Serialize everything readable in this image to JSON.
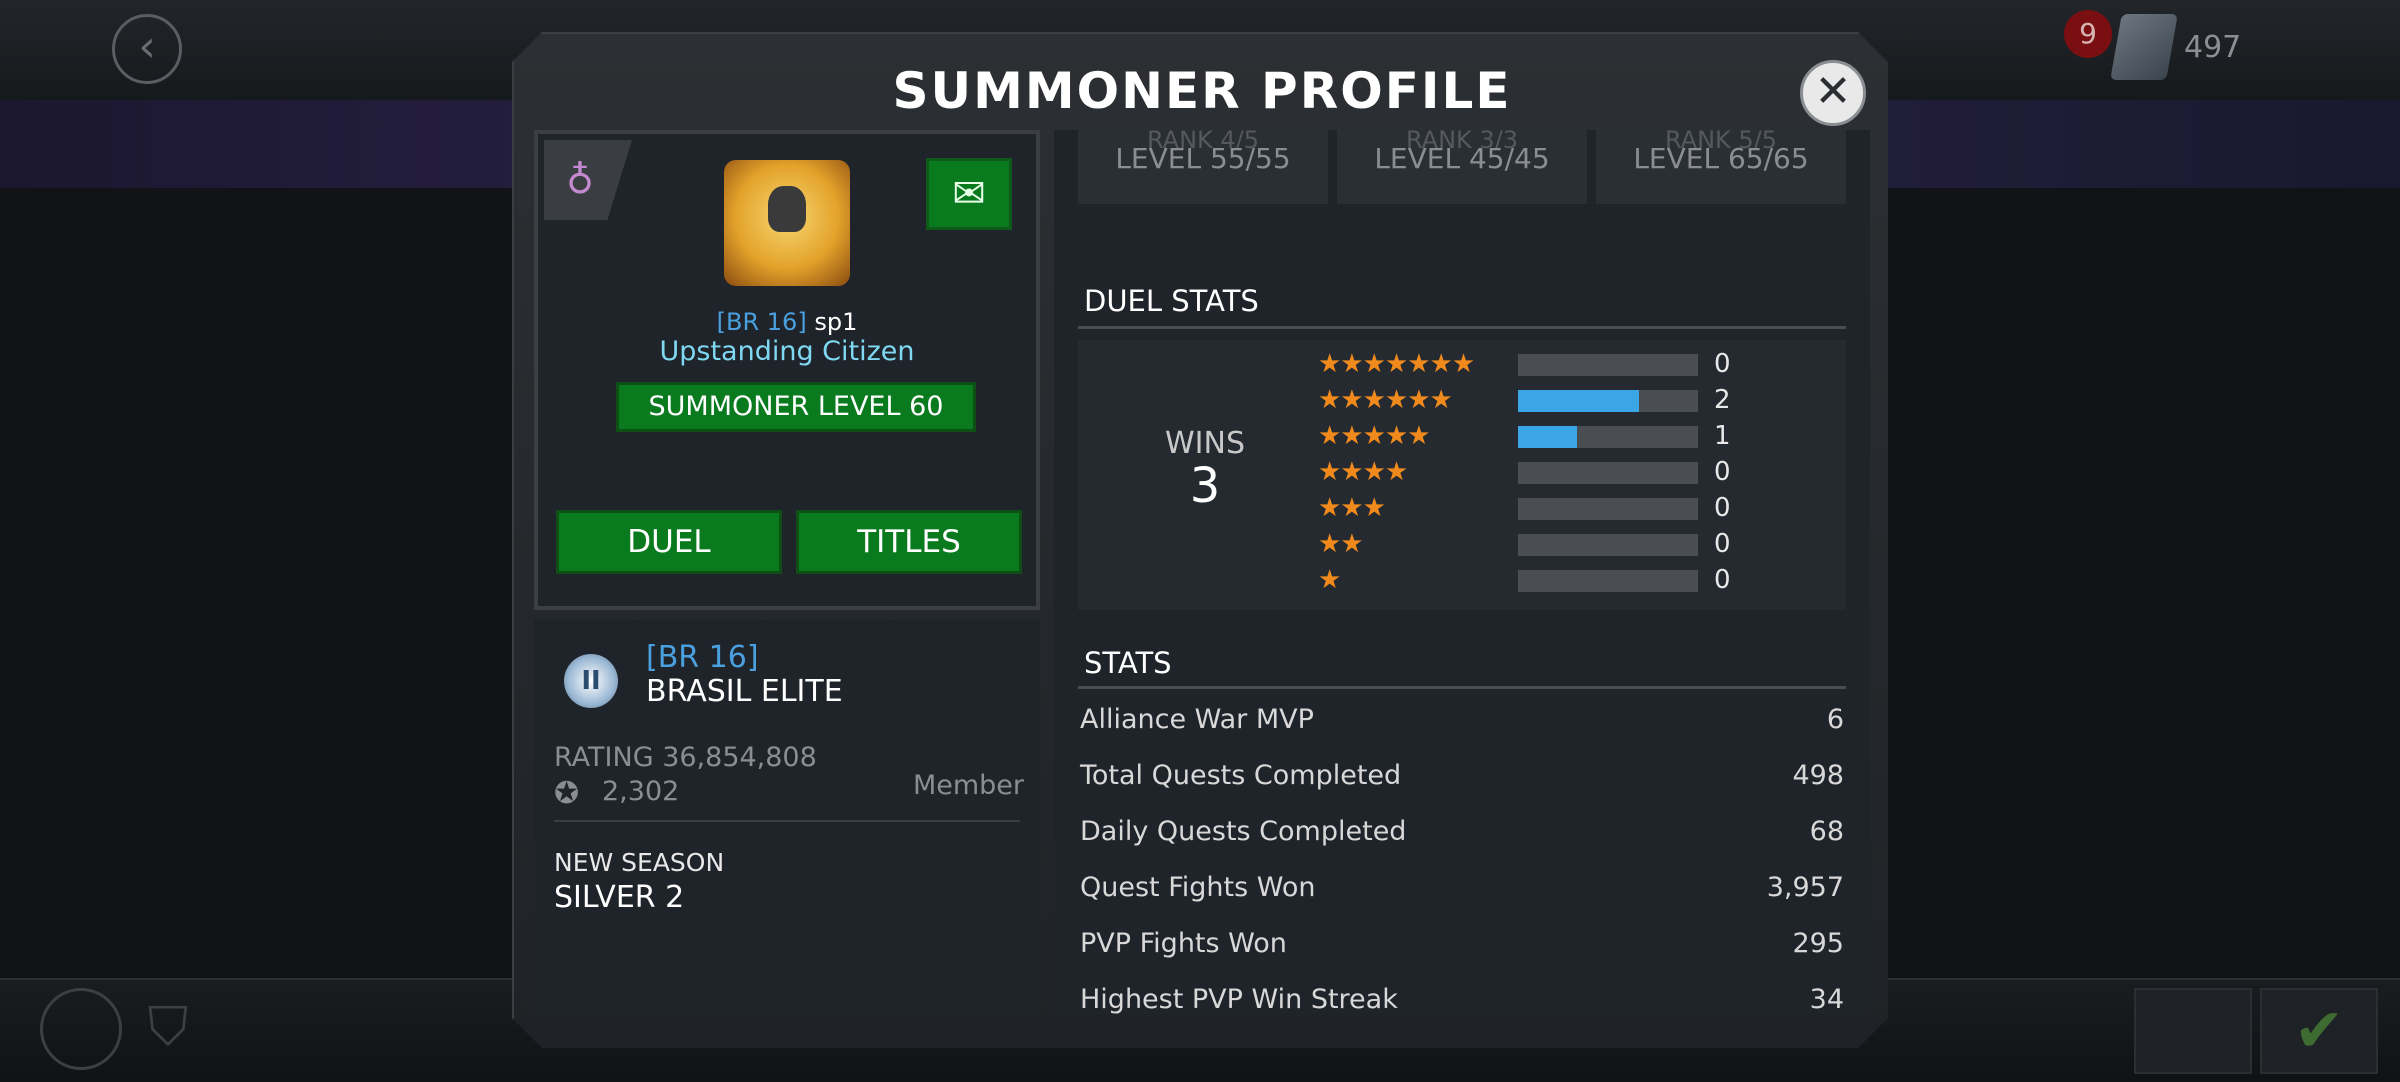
{
  "background": {
    "alert_count": "9",
    "stamina_count": "497"
  },
  "modal": {
    "title": "SUMMONER PROFILE",
    "close_symbol": "✕"
  },
  "profile": {
    "alliance_tag": "[BR 16]",
    "name": "sp1",
    "title": "Upstanding Citizen",
    "level_label": "SUMMONER LEVEL 60",
    "duel_label": "DUEL",
    "titles_label": "TITLES"
  },
  "alliance": {
    "tag": "[BR 16]",
    "name": "BRASIL ELITE",
    "rating": "RATING 36,854,808",
    "trophies": "2,302",
    "role": "Member",
    "season_label": "NEW SEASON",
    "season_value": "SILVER 2"
  },
  "ranks": [
    {
      "faded": "RANK 4/5",
      "level": "LEVEL 55/55"
    },
    {
      "faded": "RANK 3/3",
      "level": "LEVEL 45/45"
    },
    {
      "faded": "RANK 5/5",
      "level": "LEVEL 65/65"
    }
  ],
  "duel_stats": {
    "title": "DUEL STATS",
    "wins_label": "WINS",
    "wins_value": "3",
    "rows": [
      {
        "stars": "★★★★★★★",
        "count": "0",
        "fill": 0
      },
      {
        "stars": "★★★★★★",
        "count": "2",
        "fill": 0.67
      },
      {
        "stars": "★★★★★",
        "count": "1",
        "fill": 0.33
      },
      {
        "stars": "★★★★",
        "count": "0",
        "fill": 0
      },
      {
        "stars": "★★★",
        "count": "0",
        "fill": 0
      },
      {
        "stars": "★★",
        "count": "0",
        "fill": 0
      },
      {
        "stars": "★",
        "count": "0",
        "fill": 0
      }
    ]
  },
  "stats": {
    "title": "STATS",
    "rows": [
      {
        "label": "Alliance War MVP",
        "value": "6"
      },
      {
        "label": "Total Quests Completed",
        "value": "498"
      },
      {
        "label": "Daily Quests Completed",
        "value": "68"
      },
      {
        "label": "Quest Fights Won",
        "value": "3,957"
      },
      {
        "label": "PVP Fights Won",
        "value": "295"
      },
      {
        "label": "Highest PVP Win Streak",
        "value": "34"
      }
    ]
  },
  "colors": {
    "green_button": "#0a7a1f",
    "blue_accent": "#4aa0de",
    "star_orange": "#f08a1c",
    "bar_blue": "#3aa6e6"
  },
  "icons": {
    "back": "chevron-left-icon",
    "close": "close-icon",
    "mail": "mail-icon",
    "alliance_emblem": "alliance-emblem-icon",
    "trophy": "trophy-icon"
  }
}
